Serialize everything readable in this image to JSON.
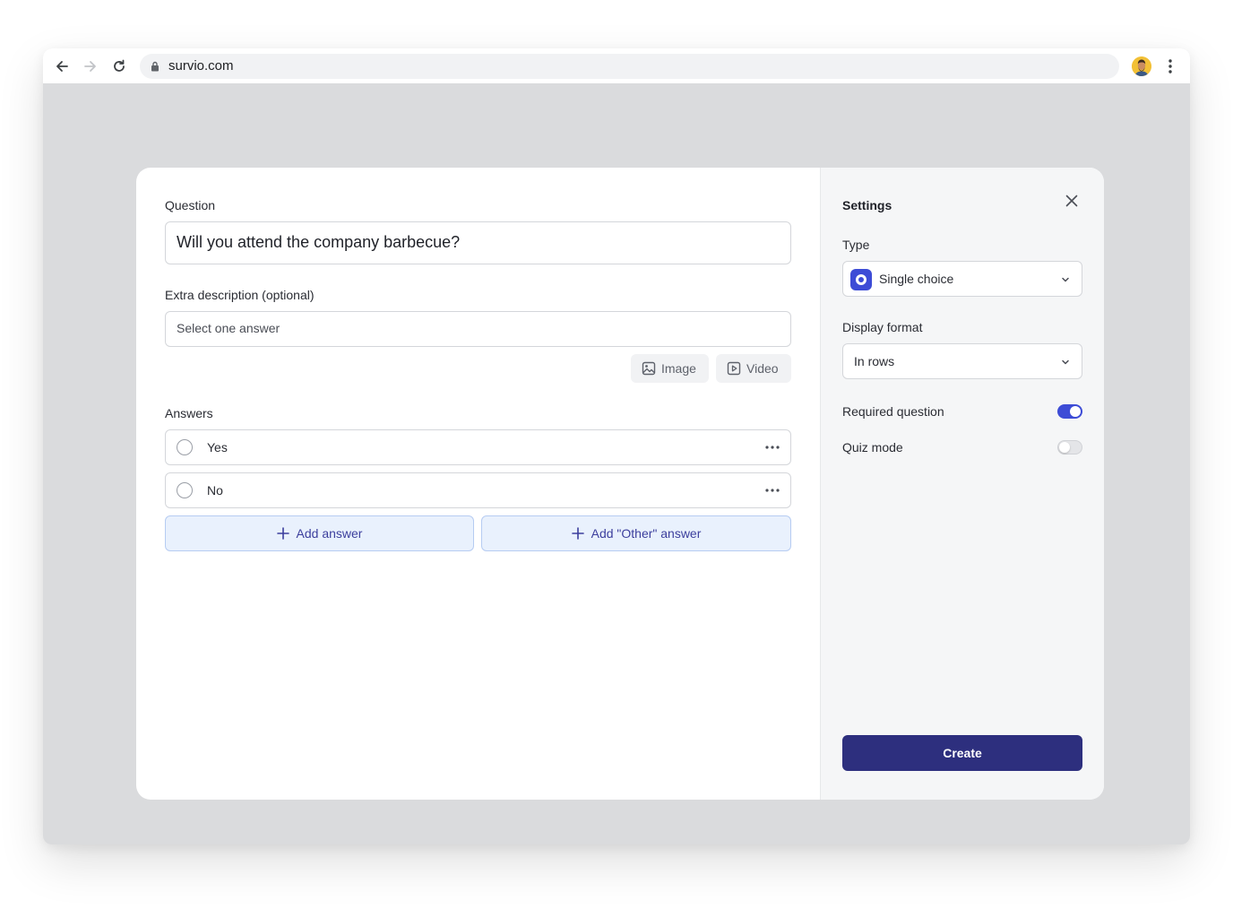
{
  "browser": {
    "url": "survio.com"
  },
  "editor": {
    "question_label": "Question",
    "question_value": "Will you attend the company barbecue?",
    "description_label": "Extra description (optional)",
    "description_value": "Select one answer",
    "image_button": "Image",
    "video_button": "Video",
    "answers_label": "Answers",
    "answers": [
      {
        "label": "Yes"
      },
      {
        "label": "No"
      }
    ],
    "add_answer": "Add answer",
    "add_other_answer": "Add \"Other\" answer"
  },
  "settings": {
    "title": "Settings",
    "type_label": "Type",
    "type_value": "Single choice",
    "display_format_label": "Display format",
    "display_format_value": "In rows",
    "required_label": "Required question",
    "required_on": true,
    "quiz_label": "Quiz mode",
    "quiz_on": false,
    "create_button": "Create"
  },
  "colors": {
    "accent": "#3d4cd6",
    "primary_button": "#2d2f7e",
    "add_button_bg": "#e9f1fd",
    "add_button_text": "#3c3f9d",
    "backdrop": "#dadbdd"
  },
  "icons": [
    "back-arrow-icon",
    "forward-arrow-icon",
    "reload-icon",
    "lock-icon",
    "user-avatar",
    "kebab-menu-icon",
    "image-icon",
    "video-icon",
    "more-options-icon",
    "plus-icon",
    "close-icon",
    "chevron-down-icon",
    "single-choice-icon"
  ]
}
